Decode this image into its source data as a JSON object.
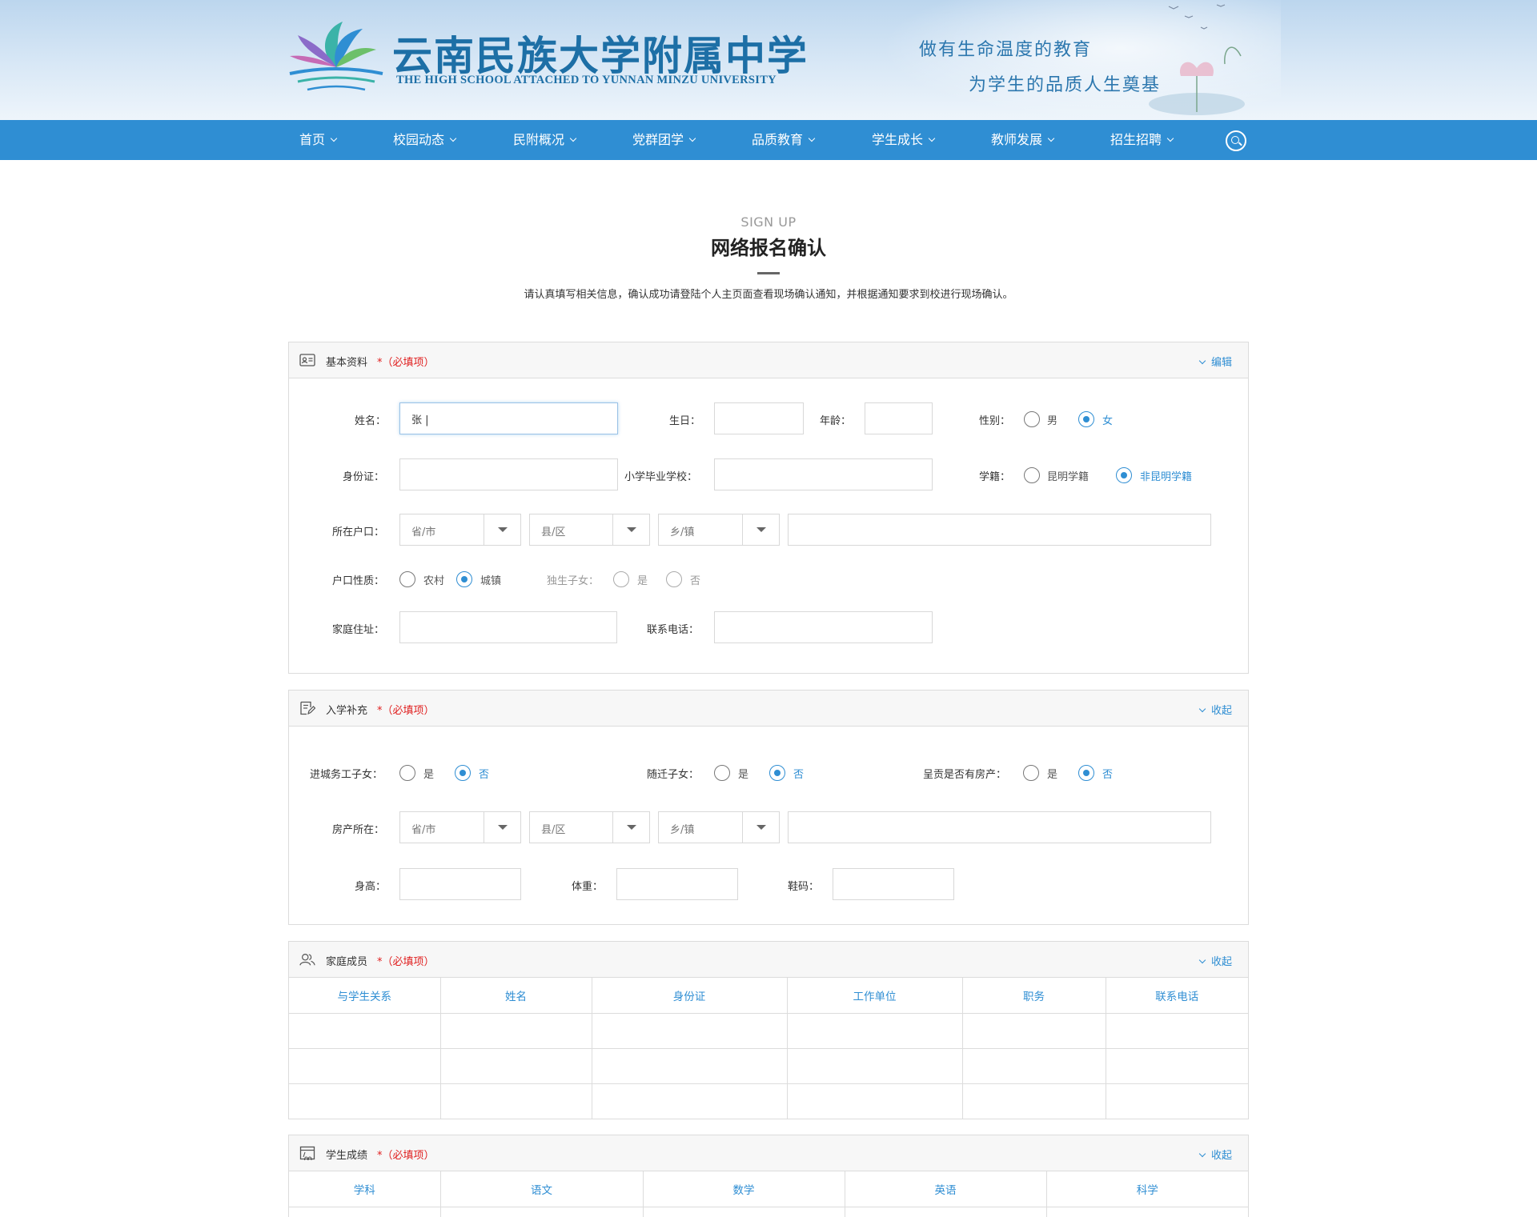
{
  "header": {
    "logo_cn": "云南民族大学附属中学",
    "logo_en": "THE HIGH SCHOOL ATTACHED TO YUNNAN MINZU UNIVERSITY",
    "slogan_1": "做有生命温度的教育",
    "slogan_2": "为学生的品质人生奠基"
  },
  "nav": {
    "items": [
      "首页",
      "校园动态",
      "民附概况",
      "党群团学",
      "品质教育",
      "学生成长",
      "教师发展",
      "招生招聘"
    ]
  },
  "page": {
    "subtitle_en": "SIGN UP",
    "title": "网络报名确认",
    "intro": "请认真填写相关信息，确认成功请登陆个人主页面查看现场确认通知，并根据通知要求到校进行现场确认。"
  },
  "common": {
    "required": "*（必填项）",
    "province": "省/市",
    "county": "县/区",
    "town": "乡/镇",
    "yes": "是",
    "no": "否"
  },
  "basic": {
    "title": "基本资料",
    "toggle": "编辑",
    "name_label": "姓名：",
    "name_value": "张 |",
    "birthday_label": "生日：",
    "age_label": "年龄：",
    "gender_label": "性别：",
    "gender_male": "男",
    "gender_female": "女",
    "idcard_label": "身份证：",
    "school_label": "小学毕业学校：",
    "registry_label": "学籍：",
    "registry_km": "昆明学籍",
    "registry_nonkm": "非昆明学籍",
    "hukou_label": "所在户口：",
    "hukou_type_label": "户口性质：",
    "rural": "农村",
    "urban": "城镇",
    "only_child_label": "独生子女：",
    "address_label": "家庭住址：",
    "phone_label": "联系电话："
  },
  "enroll": {
    "title": "入学补充",
    "toggle": "收起",
    "migrant_label": "进城务工子女：",
    "relocation_label": "随迁子女：",
    "house_label": "呈贡是否有房产：",
    "property_label": "房产所在：",
    "height_label": "身高：",
    "weight_label": "体重：",
    "shoe_label": "鞋码："
  },
  "family": {
    "title": "家庭成员",
    "toggle": "收起",
    "columns": [
      "与学生关系",
      "姓名",
      "身份证",
      "工作单位",
      "职务",
      "联系电话"
    ]
  },
  "grades": {
    "title": "学生成绩",
    "toggle": "收起",
    "columns": [
      "学科",
      "语文",
      "数学",
      "英语",
      "科学"
    ]
  },
  "colors": {
    "primary": "#2f8ed3",
    "required": "#e02020",
    "border": "#dcdcdc"
  }
}
